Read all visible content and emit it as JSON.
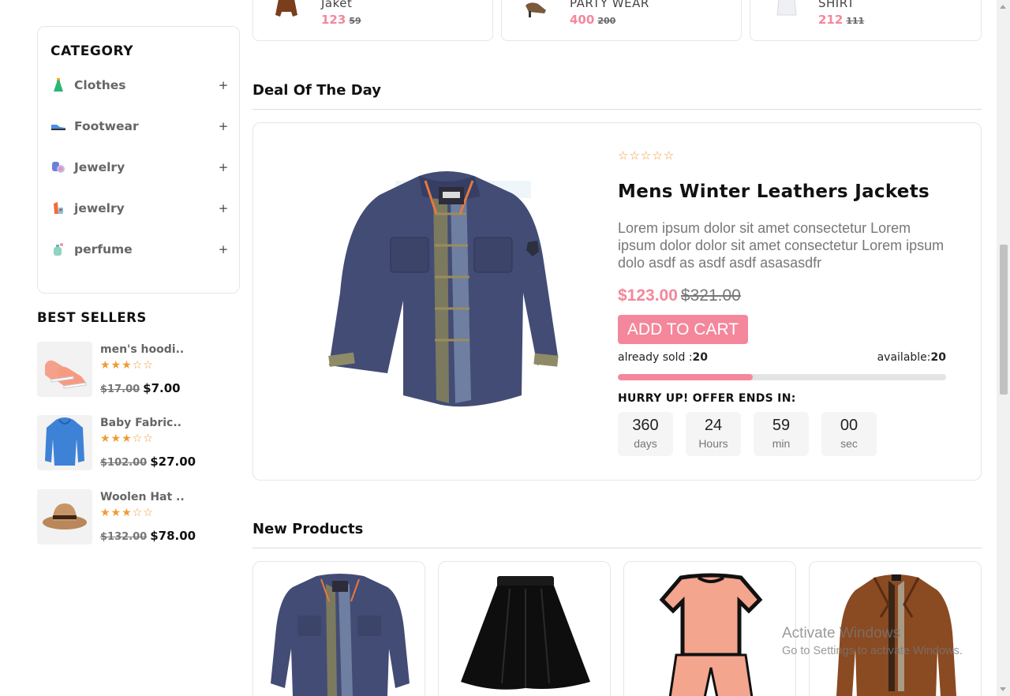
{
  "top_products": [
    {
      "name": "Jaket",
      "price": "123",
      "old_price": "59"
    },
    {
      "name": "PARTY WEAR",
      "price": "400",
      "old_price": "200"
    },
    {
      "name": "SHIRT",
      "price": "212",
      "old_price": "111"
    }
  ],
  "sidebar": {
    "category_title": "CATEGORY",
    "categories": [
      {
        "label": "Clothes",
        "icon": "dress-icon",
        "toggle": "+"
      },
      {
        "label": "Footwear",
        "icon": "shoe-icon",
        "toggle": "+"
      },
      {
        "label": "Jewelry",
        "icon": "watch-icon",
        "toggle": "+"
      },
      {
        "label": "jewelry",
        "icon": "lipstick-icon",
        "toggle": "+"
      },
      {
        "label": "perfume",
        "icon": "perfume-icon",
        "toggle": "+"
      }
    ],
    "best_sellers_title": "BEST SELLERS",
    "best_sellers": [
      {
        "name": "men's hoodi..",
        "rating": "★★★☆☆",
        "old_price": "$17.00",
        "price": "$7.00"
      },
      {
        "name": "Baby Fabric..",
        "rating": "★★★☆☆",
        "old_price": "$102.00",
        "price": "$27.00"
      },
      {
        "name": "Woolen Hat ..",
        "rating": "★★★☆☆",
        "old_price": "$132.00",
        "price": "$78.00"
      }
    ]
  },
  "deal": {
    "section_title": "Deal Of The Day",
    "rating": "☆☆☆☆☆",
    "name": "Mens Winter Leathers Jackets",
    "description": "Lorem ipsum dolor sit amet consectetur Lorem ipsum dolor dolor sit amet consectetur Lorem ipsum dolo asdf as asdf asdf asasasdfr",
    "price": "$123.00",
    "old_price": "$321.00",
    "cart_label": "ADD TO CART",
    "sold_label": "already sold :",
    "sold_value": "20",
    "available_label": "available:",
    "available_value": "20",
    "sold_fraction": 0.41,
    "hurry_label": "HURRY UP! OFFER ENDS IN:",
    "countdown": [
      {
        "value": "360",
        "unit": "days"
      },
      {
        "value": "24",
        "unit": "Hours"
      },
      {
        "value": "59",
        "unit": "min"
      },
      {
        "value": "00",
        "unit": "sec"
      }
    ]
  },
  "new_products": {
    "section_title": "New Products",
    "items": [
      "denim-jacket",
      "black-skirt",
      "pink-tshirt-set",
      "brown-coat"
    ]
  },
  "windows_watermark": {
    "line1": "Activate Windows",
    "line2": "Go to Settings to activate Windows."
  },
  "colors": {
    "accent": "#f4879b",
    "star": "#f09a34"
  }
}
